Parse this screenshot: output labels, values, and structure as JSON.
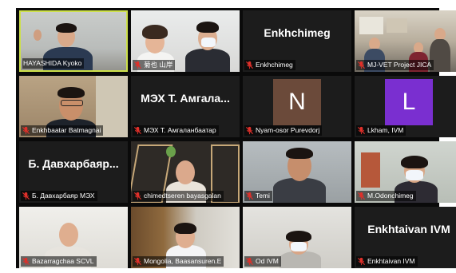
{
  "meeting": {
    "tiles": [
      {
        "label": "HAYASHIDA Kyoko",
        "muted": false,
        "active": true,
        "type": "video"
      },
      {
        "label": "菊也 山岸",
        "muted": true,
        "active": false,
        "type": "video"
      },
      {
        "label": "Enkhchimeg",
        "muted": true,
        "active": false,
        "type": "name",
        "display_name": "Enkhchimeg"
      },
      {
        "label": "MJ-VET Project JICA",
        "muted": true,
        "active": false,
        "type": "video"
      },
      {
        "label": "Enkhbaatar Batmagnai",
        "muted": true,
        "active": false,
        "type": "video"
      },
      {
        "label": "МЭХ Т. Амгаланбаатар",
        "muted": true,
        "active": false,
        "type": "name",
        "display_name": "МЭХ Т. Амгала..."
      },
      {
        "label": "Nyam-osor Purevdorj",
        "muted": true,
        "active": false,
        "type": "avatar",
        "initial": "N",
        "avatar_color": "#6b4a3a"
      },
      {
        "label": "Lkham, IVM",
        "muted": true,
        "active": false,
        "type": "avatar",
        "initial": "L",
        "avatar_color": "#7a2fd0"
      },
      {
        "label": "Б. Давхарбаяр МЭХ",
        "muted": true,
        "active": false,
        "type": "name",
        "display_name": "Б. Давхарбаяр..."
      },
      {
        "label": "chimedtseren bayasgalan",
        "muted": true,
        "active": false,
        "type": "video"
      },
      {
        "label": "Temi",
        "muted": true,
        "active": false,
        "type": "video"
      },
      {
        "label": "M.Odonchimeg",
        "muted": true,
        "active": false,
        "type": "video"
      },
      {
        "label": "Bazarragchaa SCVL",
        "muted": true,
        "active": false,
        "type": "video"
      },
      {
        "label": "Mongolia, Baasansuren.E",
        "muted": true,
        "active": false,
        "type": "video"
      },
      {
        "label": "Od   IVM",
        "muted": true,
        "active": false,
        "type": "video"
      },
      {
        "label": "Enkhtaivan IVM",
        "muted": true,
        "active": false,
        "type": "name",
        "display_name": "Enkhtaivan IVM"
      }
    ]
  },
  "colors": {
    "active_border": "#cde04a",
    "muted_mic": "#e0302a",
    "tile_bg": "#1c1c1c"
  }
}
